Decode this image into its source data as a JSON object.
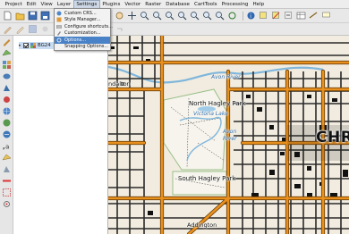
{
  "menubar": {
    "items": [
      "Project",
      "Edit",
      "View",
      "Layer",
      "Settings",
      "Plugins",
      "Vector",
      "Raster",
      "Database",
      "CartTools",
      "Processing",
      "Help"
    ],
    "active_index": 4
  },
  "settings_menu": {
    "items": [
      {
        "label": "Custom CRS...",
        "icon": "crs-icon"
      },
      {
        "label": "Style Manager...",
        "icon": "style-manager-icon"
      },
      {
        "label": "Configure shortcuts...",
        "icon": "keyboard-icon"
      },
      {
        "label": "Customization...",
        "icon": "customization-icon"
      },
      {
        "label": "Options...",
        "icon": "options-icon",
        "highlighted": true
      },
      {
        "label": "Snapping Options...",
        "icon": ""
      }
    ]
  },
  "layers_panel": {
    "layer_name": "BG24",
    "checked": true
  },
  "map": {
    "labels": {
      "town_top_left": "ndalton",
      "water_right": "Avon River",
      "park_north": "North Hagley Park",
      "lake": "Victoria Lake",
      "water_mid_1": "Avon",
      "water_mid_2": "River",
      "park_south": "South Hagley Park",
      "street_bottom": "Addington",
      "city": "CHR"
    },
    "colors": {
      "background": "#f1ecdf",
      "road_major": "#e8901e",
      "road_casing": "#5a3000",
      "road_minor": "#2a2a2a",
      "water": "#7fb6dc",
      "building": "#111111"
    }
  }
}
